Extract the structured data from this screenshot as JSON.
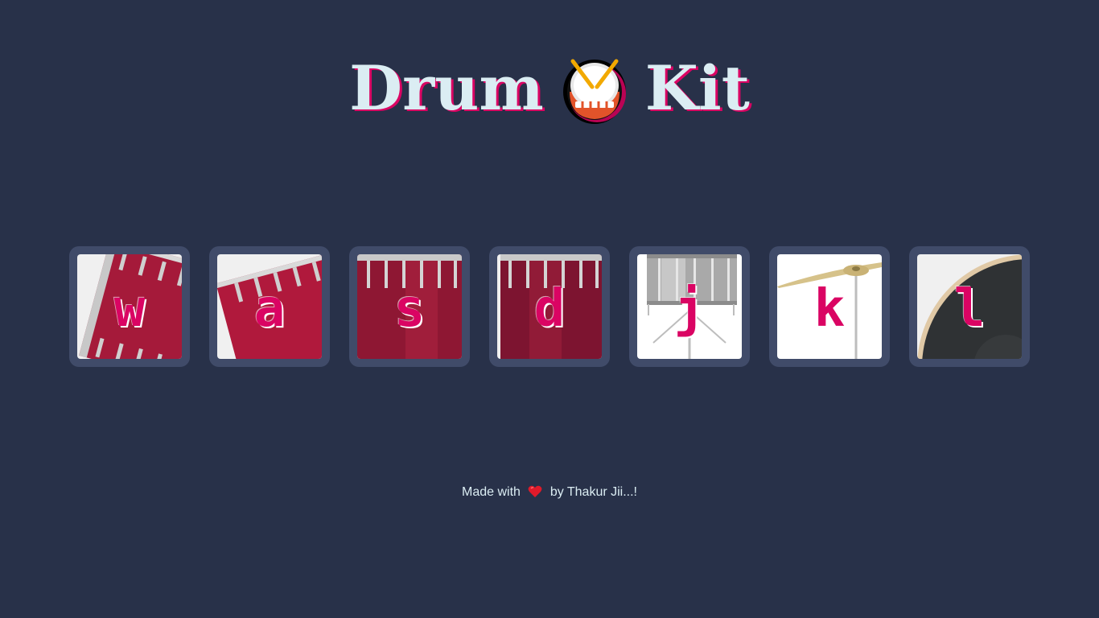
{
  "header": {
    "title_part1": "Drum",
    "title_part2": "Kit",
    "emoji_icon": "drum-icon"
  },
  "drums": [
    {
      "key": "w",
      "icon": "tom-drum-icon"
    },
    {
      "key": "a",
      "icon": "tom-drum-icon"
    },
    {
      "key": "s",
      "icon": "tom-drum-icon"
    },
    {
      "key": "d",
      "icon": "tom-drum-icon"
    },
    {
      "key": "j",
      "icon": "snare-drum-icon"
    },
    {
      "key": "k",
      "icon": "cymbal-icon"
    },
    {
      "key": "l",
      "icon": "kick-drum-icon"
    }
  ],
  "footer": {
    "prefix": "Made with",
    "heart_icon": "heart-icon",
    "suffix": "by Thakur Jii...!"
  },
  "colors": {
    "background": "#283149",
    "tile": "#404b69",
    "accent": "#da0463",
    "text": "#dbedf3"
  }
}
